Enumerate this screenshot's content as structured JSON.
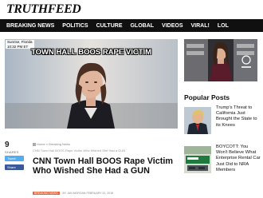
{
  "site": {
    "logo": "TRUTHFEED"
  },
  "nav": {
    "items": [
      "BREAKING NEWS",
      "POLITICS",
      "CULTURE",
      "GLOBAL",
      "VIDEOS",
      "VIRAL!",
      "LOL"
    ]
  },
  "hero": {
    "location_line1": "Sunrise, Florida",
    "location_line2": "10:32 PM ET",
    "caption": "TOWN HALL BOOS RAPE VICTIM"
  },
  "share": {
    "count": "9",
    "label": "SHARES",
    "tweet": "Tweet",
    "share": "Share"
  },
  "article": {
    "breadcrumb_home": "Home",
    "breadcrumb_sep": "»",
    "breadcrumb_section": "Breaking News",
    "subline": "CNN Town Hall BOOS Rape Victim Who Wished She Had a GUN",
    "headline": "CNN Town Hall BOOS Rape Victim Who Wished She Had a GUN",
    "category": "BREAKING NEWS",
    "byline": "BY JAN MORGAN",
    "date": "FEBRUARY 22, 2018"
  },
  "sidebar": {
    "popular_title": "Popular Posts",
    "posts": [
      {
        "title": "Trump's Threat to California Just Brought the State to its Knees"
      },
      {
        "title": "BOYCOTT: You Won't Believe What Enterprise Rental Car Just Did to NRA Members"
      }
    ]
  },
  "colors": {
    "nav_bg": "#101010",
    "twitter": "#55acee",
    "facebook": "#3b5998",
    "category_badge": "#e8663b"
  }
}
